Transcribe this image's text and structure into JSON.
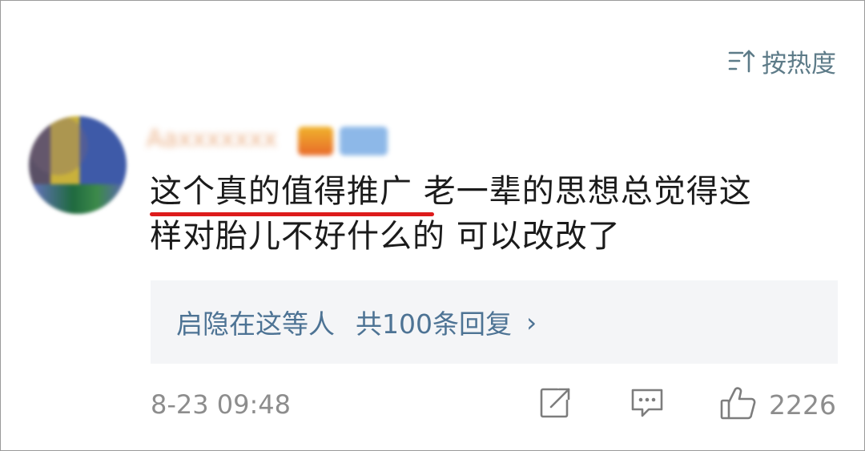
{
  "header": {
    "sort_label": "按热度",
    "sort_icon": "sort-icon"
  },
  "comment": {
    "username": "Aaxxxxxxx",
    "text_line1": "这个真的值得推广  老一辈的思想总觉得这",
    "text_line2": "样对胎儿不好什么的  可以改改了",
    "underline_color": "#dd1b1b"
  },
  "replies": {
    "author": "启隐在这等人",
    "count_label": "共100条回复",
    "chevron": "›"
  },
  "footer": {
    "timestamp": "8-23 09:48",
    "like_count": "2226",
    "icons": [
      "share-icon",
      "comment-icon",
      "like-icon"
    ]
  },
  "colors": {
    "accent": "#4d7394",
    "muted": "#8d8d8d",
    "sort": "#5d7b88"
  }
}
